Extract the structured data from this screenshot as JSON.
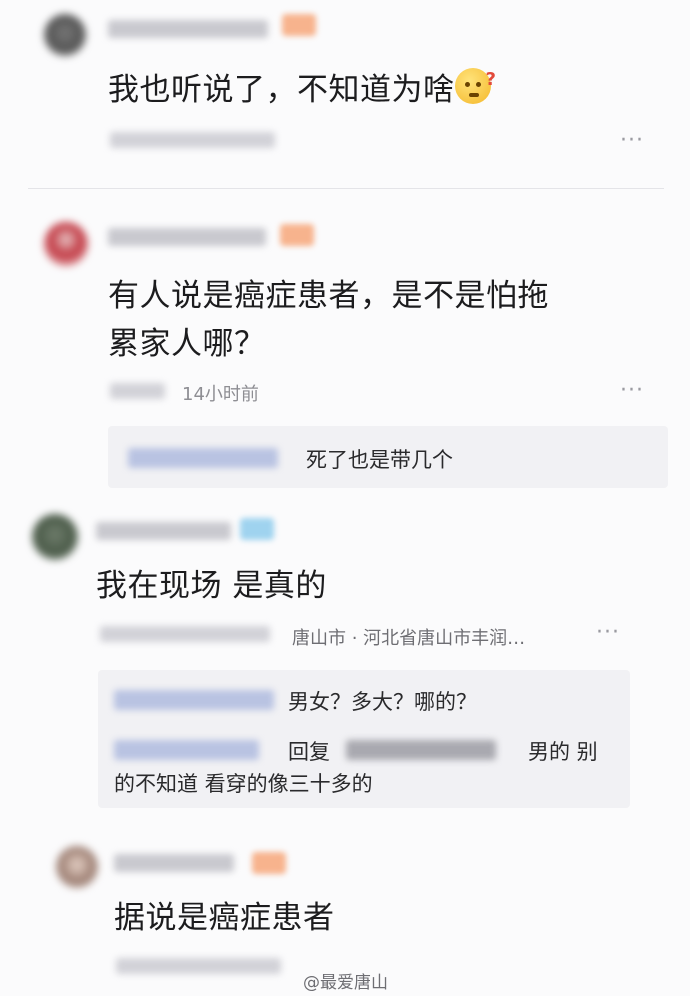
{
  "comments": [
    {
      "text": "我也听说了，不知道为啥",
      "emoji": "thinking-face-icon",
      "more": "···"
    },
    {
      "text_line1": "有人说是癌症患者，是不是怕拖",
      "text_line2": "累家人哪？",
      "time": "14小时前",
      "more": "···",
      "reply": "死了也是带几个"
    },
    {
      "text": "我在现场 是真的",
      "location": "唐山市 · 河北省唐山市丰润…",
      "more": "···",
      "reply1": "男女？多大？哪的？",
      "reply2_prefix": "回复",
      "reply2_line1": "男的 别",
      "reply2_line2": "的不知道 看穿的像三十多的"
    },
    {
      "text": "据说是癌症患者"
    }
  ],
  "watermark": "@最爱唐山",
  "colors": {
    "background": "#fbfbfc",
    "text": "#1c1c1e",
    "meta": "#8e8e93",
    "reply_bg": "#f1f1f4",
    "badge": "#f7b38d",
    "badge_blue": "#9fd3ef"
  }
}
